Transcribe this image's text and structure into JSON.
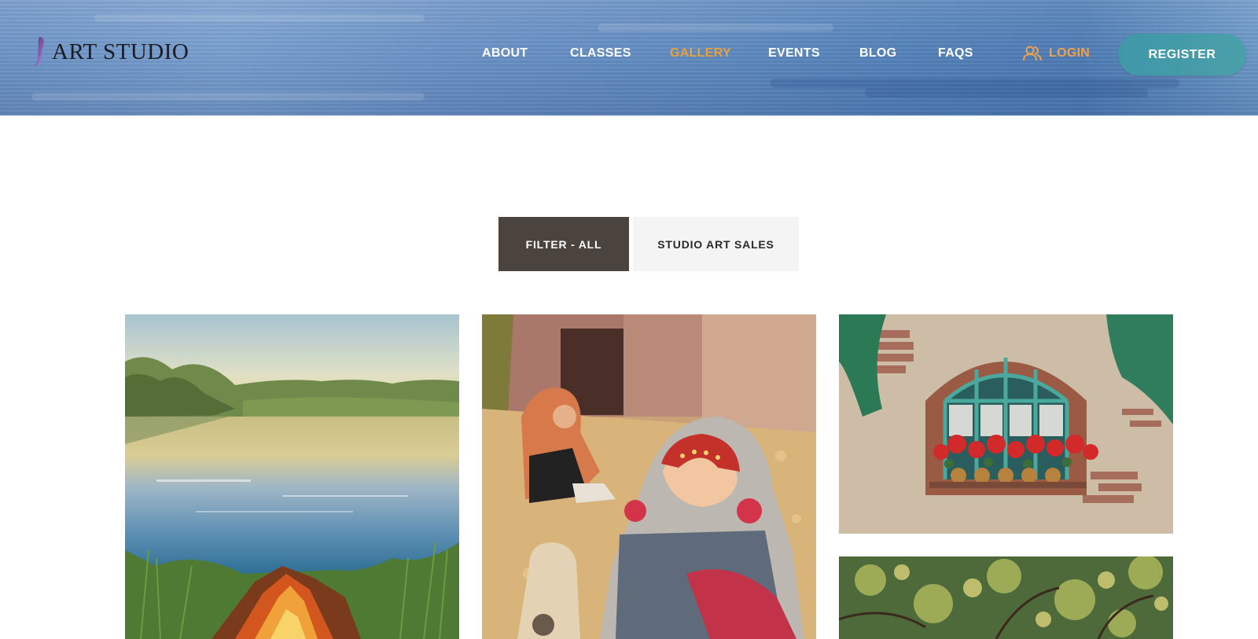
{
  "header": {
    "logo_text": "ART STUDIO",
    "nav": [
      {
        "label": "ABOUT",
        "active": false
      },
      {
        "label": "CLASSES",
        "active": false
      },
      {
        "label": "GALLERY",
        "active": true
      },
      {
        "label": "EVENTS",
        "active": false
      },
      {
        "label": "BLOG",
        "active": false
      },
      {
        "label": "FAQS",
        "active": false
      }
    ],
    "login_label": "LOGIN",
    "register_label": "REGISTER"
  },
  "filters": [
    {
      "label": "FILTER - ALL",
      "active": true
    },
    {
      "label": "STUDIO ART SALES",
      "active": false
    }
  ],
  "colors": {
    "accent_active_nav": "#e9a13b",
    "login": "#f0a24a",
    "register_button": "#3f97a8",
    "filter_active_bg": "#4b433d",
    "filter_inactive_bg": "#f4f4f4"
  },
  "gallery": [
    {
      "subject": "lake-campfire-painting"
    },
    {
      "subject": "girls-with-headscarves-painting"
    },
    {
      "subject": "window-with-flowers-painting"
    },
    {
      "subject": "tree-foliage-painting"
    }
  ]
}
